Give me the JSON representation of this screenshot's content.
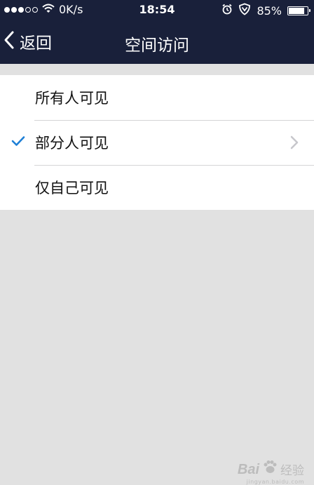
{
  "status_bar": {
    "network_speed": "0K/s",
    "time": "18:54",
    "battery_percent": "85%",
    "battery_level": 0.85,
    "icons": [
      "signal-dots-icon",
      "wifi-icon",
      "alarm-clock-icon",
      "shield-icon",
      "battery-icon"
    ]
  },
  "nav": {
    "back_label": "返回",
    "title": "空间访问"
  },
  "options": [
    {
      "label": "所有人可见",
      "selected": false,
      "has_chevron": false
    },
    {
      "label": "部分人可见",
      "selected": true,
      "has_chevron": true
    },
    {
      "label": "仅自己可见",
      "selected": false,
      "has_chevron": false
    }
  ],
  "watermark": {
    "brand": "Bai",
    "text": "经验",
    "sub": "jingyan.baidu.com"
  },
  "colors": {
    "nav_background": "#19203a",
    "page_background": "#e1e1e1",
    "checkmark": "#1e7fd6",
    "chevron": "#c7c7cc"
  }
}
